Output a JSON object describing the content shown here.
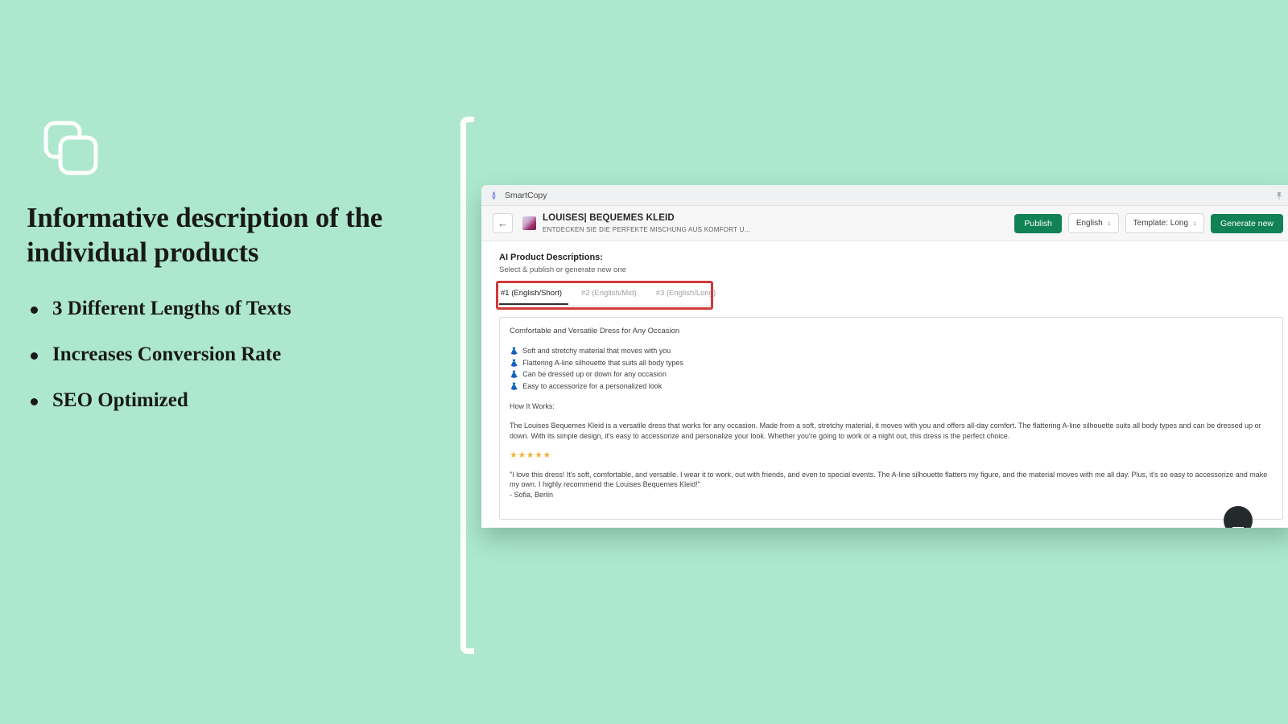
{
  "theme": {
    "background": "#ade8ce",
    "accent_green": "#118254",
    "highlight_red": "#d13a3a",
    "star_gold": "#f2b33d",
    "dress_icon_teal": "#3fc3b0"
  },
  "left_panel": {
    "icon": "copy-stack-icon",
    "headline": "Informative description of the individual products",
    "bullets": [
      "3 Different Lengths of Texts",
      "Increases Conversion Rate",
      "SEO Optimized"
    ]
  },
  "browser": {
    "tab_title": "SmartCopy",
    "favicon": "smartcopy-favicon",
    "pin_icon": "pin-icon"
  },
  "app_header": {
    "back_icon": "arrow-left-icon",
    "product_thumbnail": "product-thumbnail",
    "product_title": "LOUISES| BEQUEMES KLEID",
    "product_subtitle": "ENTDECKEN SIE DIE PERFEKTE MISCHUNG AUS KOMFORT U...",
    "publish_label": "Publish",
    "language_label": "English",
    "template_label": "Template: Long",
    "generate_label": "Generate new"
  },
  "section": {
    "title": "AI Product Descriptions:",
    "subtitle": "Select & publish or generate new one"
  },
  "tabs": [
    {
      "label": "#1 (English/Short)",
      "active": true
    },
    {
      "label": "#2 (English/Mid)",
      "active": false
    },
    {
      "label": "#3 (English/Long)",
      "active": false
    }
  ],
  "content": {
    "doc_title": "Comfortable and Versatile Dress for Any Occasion",
    "features": [
      "Soft and stretchy material that moves with you",
      "Flattering A-line silhouette that suits all body types",
      "Can be dressed up or down for any occasion",
      "Easy to accessorize for a personalized look"
    ],
    "how_it_works_heading": "How It Works:",
    "body_paragraph": "The Louises Bequemes Kleid is a versatile dress that works for any occasion. Made from a soft, stretchy material, it moves with you and offers all-day comfort. The flattering A-line silhouette suits all body types and can be dressed up or down. With its simple design, it's easy to accessorize and personalize your look. Whether you're going to work or a night out, this dress is the perfect choice.",
    "rating_stars": "★★★★★",
    "rating_value": 5,
    "testimonial": "\"I love this dress! It's soft, comfortable, and versatile. I wear it to work, out with friends, and even to special events. The A-line silhouette flatters my figure, and the material moves with me all day. Plus, it's so easy to accessorize and make my own. I highly recommend the Louises Bequemes Kleid!\"",
    "testimonial_author": "- Sofia, Berlin"
  },
  "chat": {
    "widget": "chat-bubble-button"
  }
}
